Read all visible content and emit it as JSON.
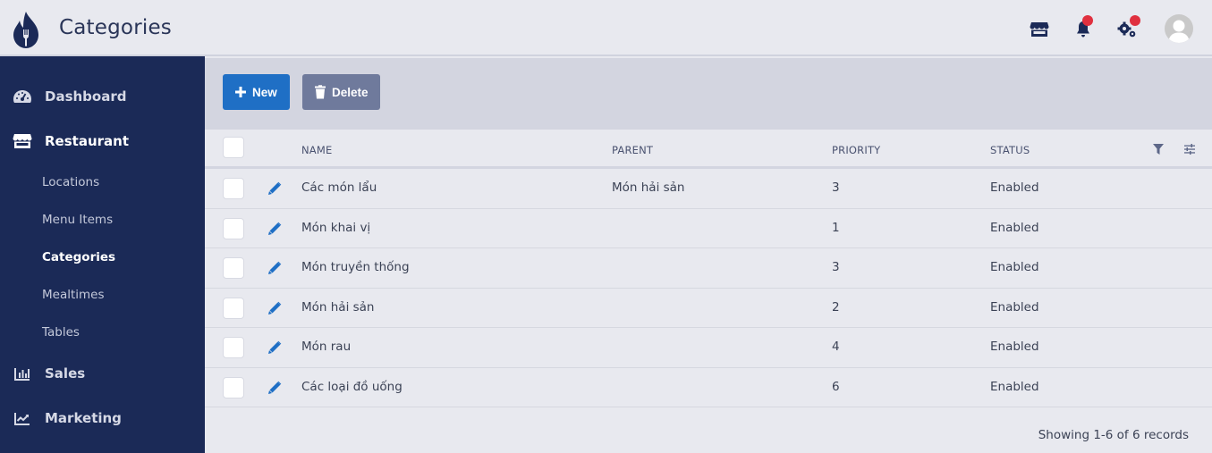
{
  "header": {
    "title": "Categories",
    "icons": [
      {
        "name": "storefront-icon",
        "badge": false
      },
      {
        "name": "bell-icon",
        "badge": true
      },
      {
        "name": "settings-icon",
        "badge": true
      },
      {
        "name": "avatar",
        "badge": false
      }
    ]
  },
  "colors": {
    "sidebar_bg": "#1b2a57",
    "primary": "#1f6fc5",
    "secondary": "#6f7a9c",
    "badge": "#e0303f"
  },
  "sidebar": {
    "items": [
      {
        "label": "Dashboard",
        "icon": "dashboard-gauge-icon",
        "active": false
      },
      {
        "label": "Restaurant",
        "icon": "storefront-icon",
        "active": true,
        "children": [
          {
            "label": "Locations",
            "active": false
          },
          {
            "label": "Menu Items",
            "active": false
          },
          {
            "label": "Categories",
            "active": true
          },
          {
            "label": "Mealtimes",
            "active": false
          },
          {
            "label": "Tables",
            "active": false
          }
        ]
      },
      {
        "label": "Sales",
        "icon": "bar-chart-icon",
        "active": false
      },
      {
        "label": "Marketing",
        "icon": "line-chart-icon",
        "active": false
      }
    ]
  },
  "toolbar": {
    "new_label": "New",
    "delete_label": "Delete"
  },
  "table": {
    "columns": [
      "NAME",
      "PARENT",
      "PRIORITY",
      "STATUS"
    ],
    "rows": [
      {
        "name": "Các món lẩu",
        "parent": "Món hải sản",
        "priority": "3",
        "status": "Enabled"
      },
      {
        "name": "Món khai vị",
        "parent": "",
        "priority": "1",
        "status": "Enabled"
      },
      {
        "name": "Món truyền thống",
        "parent": "",
        "priority": "3",
        "status": "Enabled"
      },
      {
        "name": "Món hải sản",
        "parent": "",
        "priority": "2",
        "status": "Enabled"
      },
      {
        "name": "Món rau",
        "parent": "",
        "priority": "4",
        "status": "Enabled"
      },
      {
        "name": "Các loại đồ uống",
        "parent": "",
        "priority": "6",
        "status": "Enabled"
      }
    ]
  },
  "footer": {
    "records_text": "Showing 1-6 of 6 records"
  }
}
